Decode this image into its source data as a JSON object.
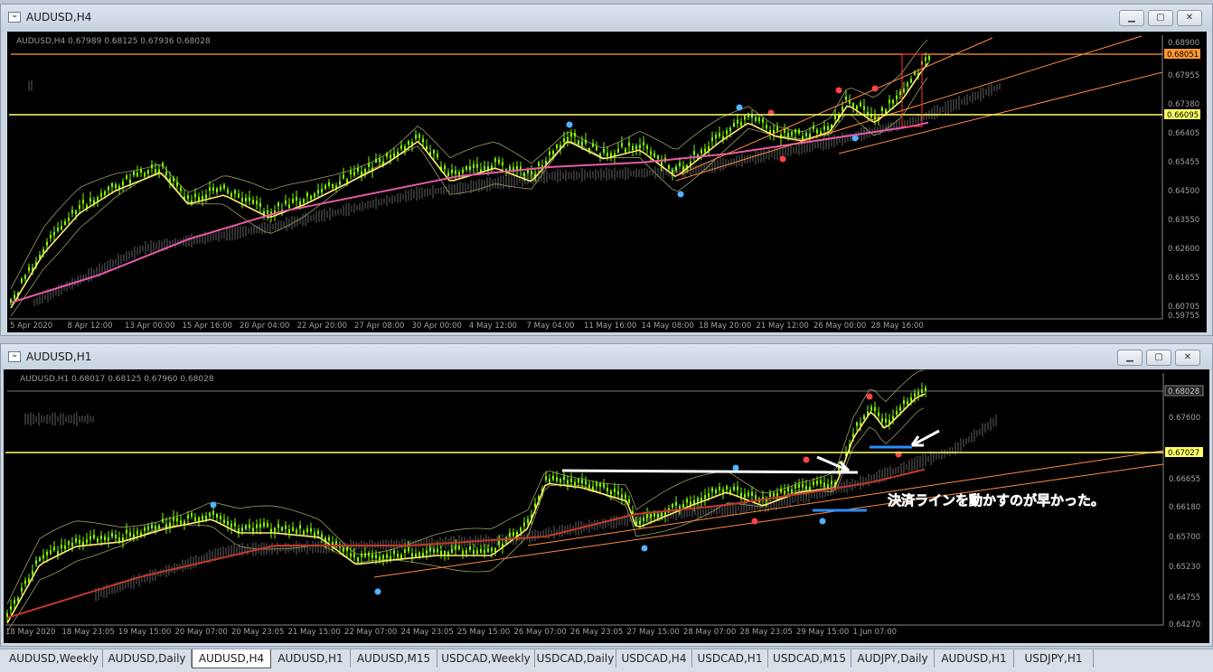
{
  "windows": [
    {
      "title": "AUDUSD,H4",
      "info": "AUDUSD,H4  0.67989 0.68125 0.67936 0.68028",
      "price_labels": [
        "0.68900",
        "0.67955",
        "0.67380",
        "0.66405",
        "0.65455",
        "0.64500",
        "0.63550",
        "0.62600",
        "0.61655",
        "0.60705",
        "0.59755"
      ],
      "time_labels": [
        "5 Apr 2020",
        "8 Apr 12:00",
        "13 Apr 00:00",
        "15 Apr 16:00",
        "20 Apr 04:00",
        "22 Apr 20:00",
        "27 Apr 08:00",
        "30 Apr 00:00",
        "4 May 12:00",
        "7 May 04:00",
        "11 May 16:00",
        "14 May 08:00",
        "18 May 20:00",
        "21 May 12:00",
        "26 May 00:00",
        "28 May 16:00"
      ],
      "hline_orange": "0.68051",
      "hline_yellow": "0.66095"
    },
    {
      "title": "AUDUSD,H1",
      "info": "AUDUSD,H1  0.68017 0.68125 0.67960 0.68028",
      "price_labels": [
        "0.68028",
        "0.67600",
        "0.67027",
        "0.66655",
        "0.66180",
        "0.65700",
        "0.65230",
        "0.64755",
        "0.64270"
      ],
      "time_labels": [
        "18 May 2020",
        "18 May 23:05",
        "19 May 15:00",
        "20 May 07:00",
        "20 May 23:05",
        "21 May 15:00",
        "22 May 07:00",
        "24 May 23:05",
        "25 May 15:00",
        "26 May 07:00",
        "26 May 23:05",
        "27 May 15:00",
        "28 May 07:00",
        "28 May 23:05",
        "29 May 15:00",
        "1 Jun 07:00"
      ],
      "hline_yellow": "0.67027",
      "annotation": "決済ラインを動かすのが早かった。"
    }
  ],
  "tabs": [
    "AUDUSD,Weekly",
    "AUDUSD,Daily",
    "AUDUSD,H4",
    "AUDUSD,H1",
    "AUDUSD,M15",
    "USDCAD,Weekly",
    "USDCAD,Daily",
    "USDCAD,H4",
    "USDCAD,H1",
    "USDCAD,M15",
    "AUDJPY,Daily",
    "AUDUSD,H1",
    "USDJPY,H1"
  ],
  "active_tab": "AUDUSD,H4",
  "colors": {
    "candle": "#7cfc00",
    "ma_fast": "#ffeb6b",
    "ma_slow": "#ff69b4",
    "hline": "#ffff66",
    "hline_orange": "#ff9933",
    "trend": "#ff8c42",
    "text_annot": "#2d8cff"
  }
}
